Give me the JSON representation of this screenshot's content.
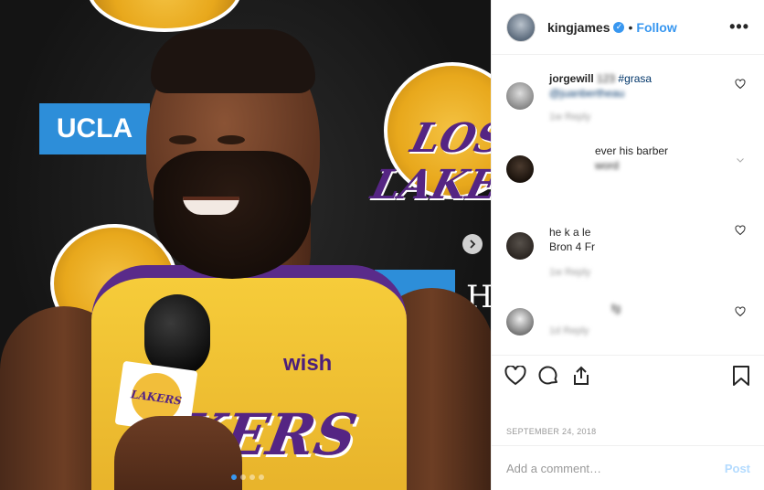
{
  "photo": {
    "backdrop": {
      "ucla_label": "UCLA",
      "lakers_label": "LOS LAKERS",
      "partial_letter": "H"
    },
    "jersey": {
      "sponsor": "wish",
      "lettering": "KERS"
    },
    "mic_flag_text": "LAKERS",
    "carousel": {
      "total": 4,
      "active_index": 0
    },
    "colors": {
      "lakers_gold": "#f4c242",
      "lakers_purple": "#552583",
      "ucla_blue": "#2d8ed9"
    }
  },
  "header": {
    "username": "kingjames",
    "verified_icon": "verified-badge-icon",
    "separator": "•",
    "follow_label": "Follow",
    "more_label": "•••"
  },
  "comments": [
    {
      "user": "jorgewill",
      "text_a": "123 ",
      "hashtag": "#grasa",
      "text_b": " @juanbertheau",
      "meta": "1w Reply",
      "liked": false
    },
    {
      "user": "",
      "text_a": "ever his barber",
      "hashtag": "",
      "text_b": "word",
      "meta": "",
      "liked": false
    },
    {
      "user": "",
      "text_a": "he k a le",
      "hashtag": "",
      "text_b": "Bron 4 Fr",
      "meta": "1w Reply",
      "liked": false
    },
    {
      "user": "",
      "text_a": "fg",
      "hashtag": "",
      "text_b": "",
      "meta": "1d Reply",
      "liked": false
    }
  ],
  "actions": {
    "like_icon": "heart-icon",
    "comment_icon": "speech-bubble-icon",
    "share_icon": "share-icon",
    "save_icon": "bookmark-icon"
  },
  "date": "SEPTEMBER 24, 2018",
  "comment_box": {
    "placeholder": "Add a comment…",
    "post_label": "Post"
  },
  "colors": {
    "accent": "#3897f0",
    "text": "#262626",
    "muted": "#999999"
  }
}
